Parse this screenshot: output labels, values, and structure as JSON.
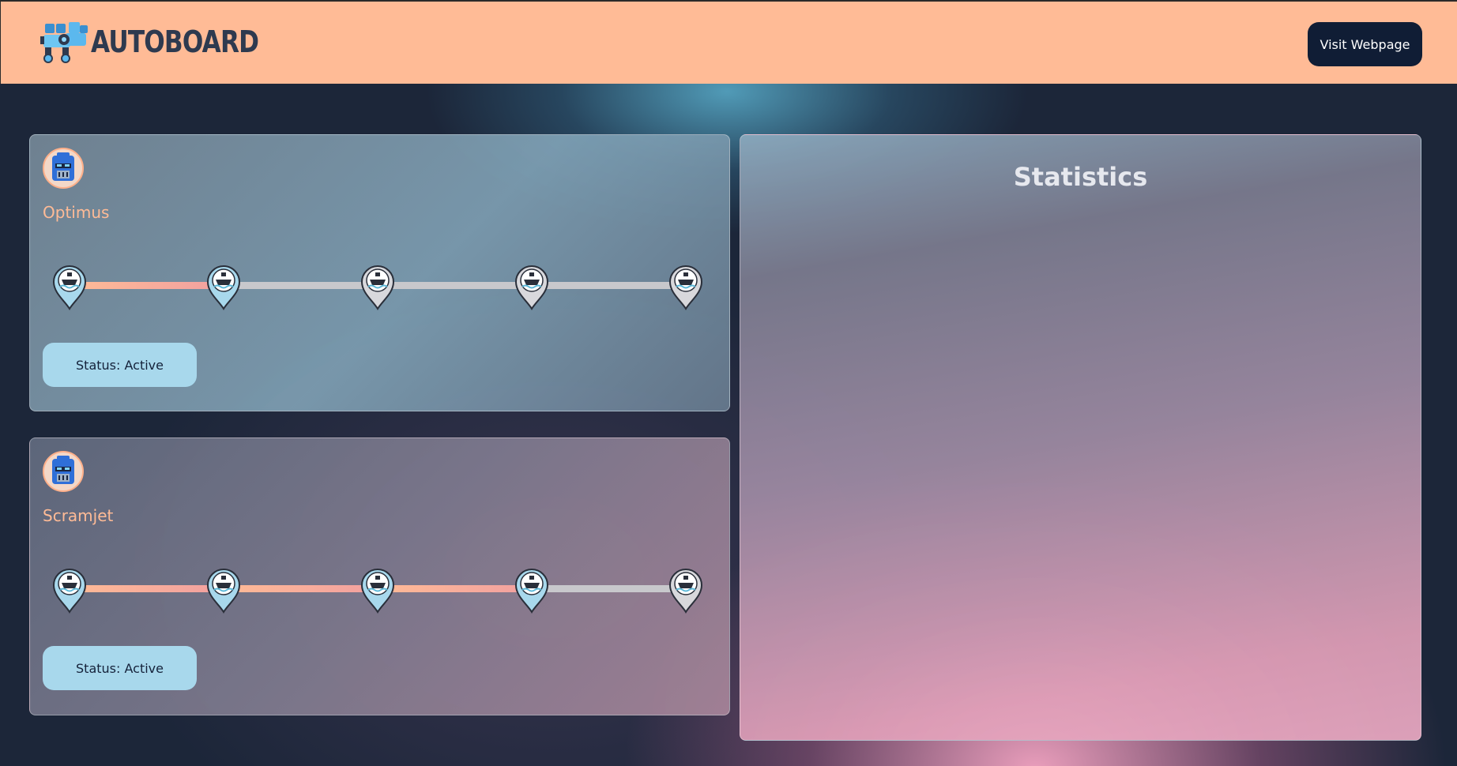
{
  "header": {
    "brand": "AUTOBOARD",
    "visit_label": "Visit Webpage"
  },
  "robots": [
    {
      "name": "Optimus",
      "status": "Status: Active",
      "completed_stops": 2,
      "total_stops": 5
    },
    {
      "name": "Scramjet",
      "status": "Status: Active",
      "completed_stops": 4,
      "total_stops": 5
    }
  ],
  "stats": {
    "title": "Statistics"
  },
  "colors": {
    "header_bg": "#ffbb96",
    "accent": "#ffbb96",
    "status_bg": "#a8d8ec",
    "button_dark": "#101d35",
    "pin_active": "#a8d8ec",
    "pin_inactive": "#d8d8dc"
  },
  "icons": {
    "logo": "robot-logo-icon",
    "avatar": "robot-head-icon",
    "stop": "ship-location-pin-icon"
  }
}
